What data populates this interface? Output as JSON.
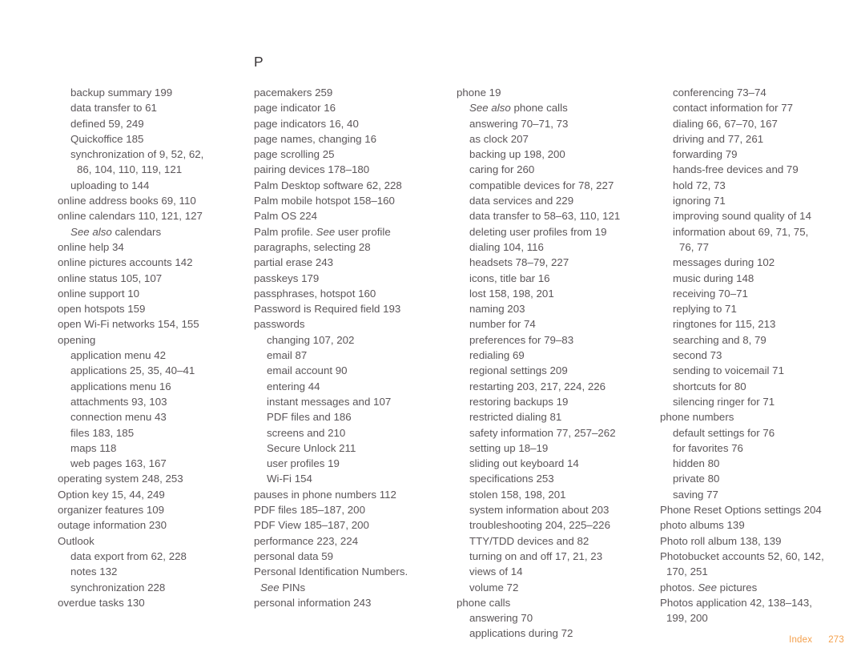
{
  "document": {
    "type": "book-index-page",
    "footer": {
      "section_label": "Index",
      "page_number": "273",
      "accent_color": "#f4a04c"
    },
    "text_color": "#5b5659",
    "heading_color": "#3a3638"
  },
  "columns": [
    {
      "id": "column-1",
      "letter_heading": "",
      "entries": [
        {
          "level": 1,
          "text": "backup summary 199"
        },
        {
          "level": 1,
          "text": "data transfer to 61"
        },
        {
          "level": 1,
          "text": "defined 59, 249"
        },
        {
          "level": 1,
          "text": "Quickoffice 185"
        },
        {
          "level": 1,
          "text": "synchronization of 9, 52, 62,"
        },
        {
          "level": 1,
          "runover": true,
          "text": "86, 104, 110, 119, 121"
        },
        {
          "level": 1,
          "text": "uploading to 144"
        },
        {
          "level": 0,
          "text": "online address books 69, 110"
        },
        {
          "level": 0,
          "text": "online calendars 110, 121, 127"
        },
        {
          "level": 1,
          "xref": true,
          "see": "See also",
          "rest": " calendars"
        },
        {
          "level": 0,
          "text": "online help 34"
        },
        {
          "level": 0,
          "text": "online pictures accounts 142"
        },
        {
          "level": 0,
          "text": "online status 105, 107"
        },
        {
          "level": 0,
          "text": "online support 10"
        },
        {
          "level": 0,
          "text": "open hotspots 159"
        },
        {
          "level": 0,
          "text": "open Wi-Fi networks 154, 155"
        },
        {
          "level": 0,
          "text": "opening"
        },
        {
          "level": 1,
          "text": "application menu 42"
        },
        {
          "level": 1,
          "text": "applications 25, 35, 40–41"
        },
        {
          "level": 1,
          "text": "applications menu 16"
        },
        {
          "level": 1,
          "text": "attachments 93, 103"
        },
        {
          "level": 1,
          "text": "connection menu 43"
        },
        {
          "level": 1,
          "text": "files 183, 185"
        },
        {
          "level": 1,
          "text": "maps 118"
        },
        {
          "level": 1,
          "text": "web pages 163, 167"
        },
        {
          "level": 0,
          "text": "operating system 248, 253"
        },
        {
          "level": 0,
          "text": "Option key 15, 44, 249"
        },
        {
          "level": 0,
          "text": "organizer features 109"
        },
        {
          "level": 0,
          "text": "outage information 230"
        },
        {
          "level": 0,
          "text": "Outlook"
        },
        {
          "level": 1,
          "text": "data export from 62, 228"
        },
        {
          "level": 1,
          "text": "notes 132"
        },
        {
          "level": 1,
          "text": "synchronization 228"
        },
        {
          "level": 0,
          "text": "overdue tasks 130"
        }
      ]
    },
    {
      "id": "column-2",
      "letter_heading": "P",
      "entries": [
        {
          "level": 0,
          "text": "pacemakers 259"
        },
        {
          "level": 0,
          "text": "page indicator 16"
        },
        {
          "level": 0,
          "text": "page indicators 16, 40"
        },
        {
          "level": 0,
          "text": "page names, changing 16"
        },
        {
          "level": 0,
          "text": "page scrolling 25"
        },
        {
          "level": 0,
          "text": "pairing devices 178–180"
        },
        {
          "level": 0,
          "text": "Palm Desktop software 62, 228"
        },
        {
          "level": 0,
          "text": "Palm mobile hotspot 158–160"
        },
        {
          "level": 0,
          "text": "Palm OS 224"
        },
        {
          "level": 0,
          "xref": true,
          "prefix": "Palm profile. ",
          "see": "See",
          "rest": " user profile"
        },
        {
          "level": 0,
          "text": "paragraphs, selecting 28"
        },
        {
          "level": 0,
          "text": "partial erase 243"
        },
        {
          "level": 0,
          "text": "passkeys 179"
        },
        {
          "level": 0,
          "text": "passphrases, hotspot 160"
        },
        {
          "level": 0,
          "text": "Password is Required field 193"
        },
        {
          "level": 0,
          "text": "passwords"
        },
        {
          "level": 1,
          "text": "changing 107, 202"
        },
        {
          "level": 1,
          "text": "email 87"
        },
        {
          "level": 1,
          "text": "email account 90"
        },
        {
          "level": 1,
          "text": "entering 44"
        },
        {
          "level": 1,
          "text": "instant messages and 107"
        },
        {
          "level": 1,
          "text": "PDF files and 186"
        },
        {
          "level": 1,
          "text": "screens and 210"
        },
        {
          "level": 1,
          "text": "Secure Unlock 211"
        },
        {
          "level": 1,
          "text": "user profiles 19"
        },
        {
          "level": 1,
          "text": "Wi-Fi 154"
        },
        {
          "level": 0,
          "text": "pauses in phone numbers 112"
        },
        {
          "level": 0,
          "text": "PDF files 185–187, 200"
        },
        {
          "level": 0,
          "text": "PDF View 185–187, 200"
        },
        {
          "level": 0,
          "text": "performance 223, 224"
        },
        {
          "level": 0,
          "text": "personal data 59"
        },
        {
          "level": 0,
          "text": "Personal Identification Numbers."
        },
        {
          "level": 0,
          "runover": true,
          "xref": true,
          "see": "See",
          "rest": " PINs"
        },
        {
          "level": 0,
          "text": "personal information 243"
        }
      ]
    },
    {
      "id": "column-3",
      "letter_heading": "",
      "entries": [
        {
          "level": 0,
          "text": "phone 19"
        },
        {
          "level": 1,
          "xref": true,
          "see": "See also",
          "rest": " phone calls"
        },
        {
          "level": 1,
          "text": "answering 70–71, 73"
        },
        {
          "level": 1,
          "text": "as clock 207"
        },
        {
          "level": 1,
          "text": "backing up 198, 200"
        },
        {
          "level": 1,
          "text": "caring for 260"
        },
        {
          "level": 1,
          "text": "compatible devices for 78, 227"
        },
        {
          "level": 1,
          "text": "data services and 229"
        },
        {
          "level": 1,
          "text": "data transfer to 58–63, 110, 121"
        },
        {
          "level": 1,
          "text": "deleting user profiles from 19"
        },
        {
          "level": 1,
          "text": "dialing 104, 116"
        },
        {
          "level": 1,
          "text": "headsets 78–79, 227"
        },
        {
          "level": 1,
          "text": "icons, title bar 16"
        },
        {
          "level": 1,
          "text": "lost 158, 198, 201"
        },
        {
          "level": 1,
          "text": "naming 203"
        },
        {
          "level": 1,
          "text": "number for 74"
        },
        {
          "level": 1,
          "text": "preferences for 79–83"
        },
        {
          "level": 1,
          "text": "redialing 69"
        },
        {
          "level": 1,
          "text": "regional settings 209"
        },
        {
          "level": 1,
          "text": "restarting 203, 217, 224, 226"
        },
        {
          "level": 1,
          "text": "restoring backups 19"
        },
        {
          "level": 1,
          "text": "restricted dialing 81"
        },
        {
          "level": 1,
          "text": "safety information 77, 257–262"
        },
        {
          "level": 1,
          "text": "setting up 18–19"
        },
        {
          "level": 1,
          "text": "sliding out keyboard 14"
        },
        {
          "level": 1,
          "text": "specifications 253"
        },
        {
          "level": 1,
          "text": "stolen 158, 198, 201"
        },
        {
          "level": 1,
          "text": "system information about 203"
        },
        {
          "level": 1,
          "text": "troubleshooting 204, 225–226"
        },
        {
          "level": 1,
          "text": "TTY/TDD devices and 82"
        },
        {
          "level": 1,
          "text": "turning on and off 17, 21, 23"
        },
        {
          "level": 1,
          "text": "views of 14"
        },
        {
          "level": 1,
          "text": "volume 72"
        },
        {
          "level": 0,
          "text": "phone calls"
        },
        {
          "level": 1,
          "text": "answering 70"
        },
        {
          "level": 1,
          "text": "applications during 72"
        }
      ]
    },
    {
      "id": "column-4",
      "letter_heading": "",
      "entries": [
        {
          "level": 1,
          "text": "conferencing 73–74"
        },
        {
          "level": 1,
          "text": "contact information for 77"
        },
        {
          "level": 1,
          "text": "dialing 66, 67–70, 167"
        },
        {
          "level": 1,
          "text": "driving and 77, 261"
        },
        {
          "level": 1,
          "text": "forwarding 79"
        },
        {
          "level": 1,
          "text": "hands-free devices and 79"
        },
        {
          "level": 1,
          "text": "hold 72, 73"
        },
        {
          "level": 1,
          "text": "ignoring 71"
        },
        {
          "level": 1,
          "text": "improving sound quality of 14"
        },
        {
          "level": 1,
          "text": "information about 69, 71, 75,"
        },
        {
          "level": 1,
          "runover": true,
          "text": "76, 77"
        },
        {
          "level": 1,
          "text": "messages during 102"
        },
        {
          "level": 1,
          "text": "music during 148"
        },
        {
          "level": 1,
          "text": "receiving 70–71"
        },
        {
          "level": 1,
          "text": "replying to 71"
        },
        {
          "level": 1,
          "text": "ringtones for 115, 213"
        },
        {
          "level": 1,
          "text": "searching and 8, 79"
        },
        {
          "level": 1,
          "text": "second 73"
        },
        {
          "level": 1,
          "text": "sending to voicemail 71"
        },
        {
          "level": 1,
          "text": "shortcuts for 80"
        },
        {
          "level": 1,
          "text": "silencing ringer for 71"
        },
        {
          "level": 0,
          "text": "phone numbers"
        },
        {
          "level": 1,
          "text": "default settings for 76"
        },
        {
          "level": 1,
          "text": "for favorites 76"
        },
        {
          "level": 1,
          "text": "hidden 80"
        },
        {
          "level": 1,
          "text": "private 80"
        },
        {
          "level": 1,
          "text": "saving 77"
        },
        {
          "level": 0,
          "text": "Phone Reset Options settings 204"
        },
        {
          "level": 0,
          "text": "photo albums 139"
        },
        {
          "level": 0,
          "text": "Photo roll album 138, 139"
        },
        {
          "level": 0,
          "text": "Photobucket accounts 52, 60, 142,"
        },
        {
          "level": 0,
          "runover": true,
          "text": "170, 251"
        },
        {
          "level": 0,
          "xref": true,
          "prefix": "photos. ",
          "see": "See",
          "rest": " pictures"
        },
        {
          "level": 0,
          "text": "Photos application 42, 138–143,"
        },
        {
          "level": 0,
          "runover": true,
          "text": "199, 200"
        }
      ]
    }
  ]
}
